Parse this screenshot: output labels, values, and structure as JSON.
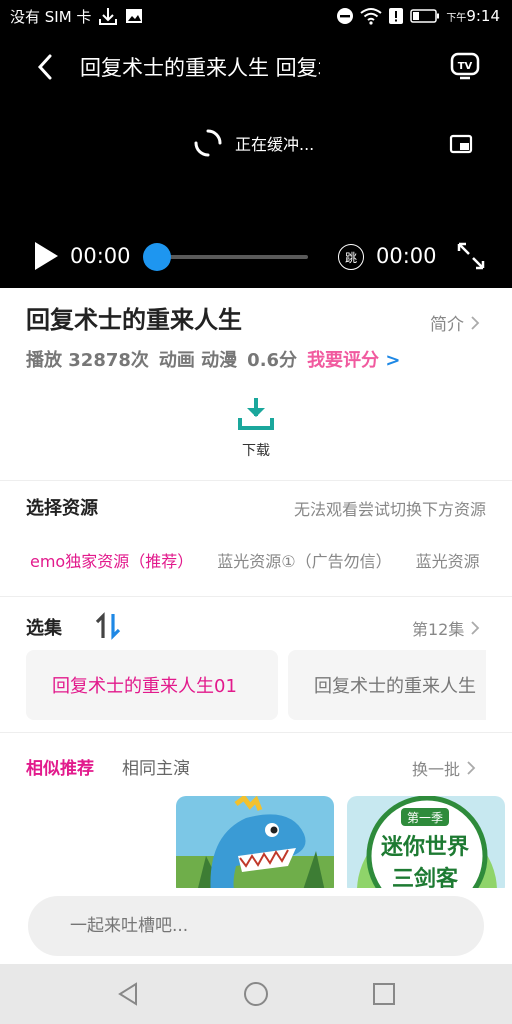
{
  "status_bar": {
    "carrier": "没有 SIM 卡",
    "time": "9:14",
    "time_prefix": "下午"
  },
  "player": {
    "title": "回复术士的重来人生  回复术士的重",
    "buffering_text": "正在缓冲...",
    "current_time": "00:00",
    "total_time": "00:00",
    "skip_label": "跳",
    "progress": 0
  },
  "info": {
    "title": "回复术士的重来人生",
    "intro_label": "简介",
    "plays": "播放 32878次",
    "genre": "动画 动漫",
    "score": "0.6分",
    "rate_label": "我要评分"
  },
  "download": {
    "label": "下载"
  },
  "sources": {
    "title": "选择资源",
    "hint": "无法观看尝试切换下方资源",
    "tabs": [
      {
        "label": "emo独家资源（推荐）",
        "active": true
      },
      {
        "label": "蓝光资源①（广告勿信）",
        "active": false
      },
      {
        "label": "蓝光资源",
        "active": false
      }
    ]
  },
  "episodes": {
    "title": "选集",
    "more_label": "第12集",
    "items": [
      {
        "label": "回复术士的重来人生01",
        "active": true
      },
      {
        "label": "回复术士的重来人生",
        "active": false
      }
    ]
  },
  "recommend": {
    "tabs": [
      {
        "label": "相似推荐",
        "active": true
      },
      {
        "label": "相同主演",
        "active": false
      }
    ],
    "refresh_label": "换一批",
    "thumb2_badge": "第一季",
    "thumb2_title1": "迷你世界",
    "thumb2_title2": "三剑客"
  },
  "comment": {
    "placeholder": "一起来吐槽吧..."
  },
  "colors": {
    "accent": "#e21a8c",
    "progress": "#1e96f0",
    "download": "#1aa79c"
  }
}
